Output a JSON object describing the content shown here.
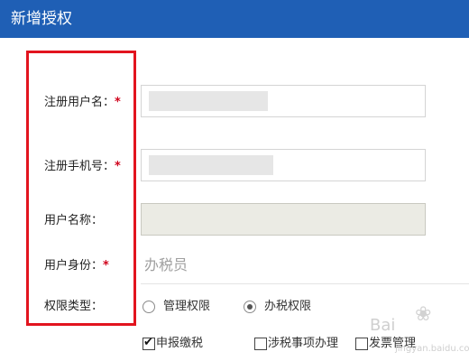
{
  "header": {
    "title": "新增授权"
  },
  "form": {
    "reg_username": {
      "label": "注册用户名：",
      "required_mark": "*"
    },
    "reg_phone": {
      "label": "注册手机号：",
      "required_mark": "*"
    },
    "user_name": {
      "label": "用户名称："
    },
    "user_identity": {
      "label": "用户身份：",
      "required_mark": "*",
      "value": "办税员"
    },
    "permission_type": {
      "label": "权限类型：",
      "options": [
        {
          "label": "管理权限",
          "selected": false
        },
        {
          "label": "办税权限",
          "selected": true
        }
      ]
    },
    "tax_permissions": [
      {
        "label": "申报缴税",
        "checked": true
      },
      {
        "label": "涉税事项办理",
        "checked": false
      },
      {
        "label": "发票管理",
        "checked": false
      }
    ]
  },
  "watermark": {
    "text": "Bai",
    "sub": "jingyan.baidu.com"
  },
  "colors": {
    "header_bg": "#1f5fb5",
    "required": "#d0021b",
    "annotation_box": "#e2141e"
  }
}
